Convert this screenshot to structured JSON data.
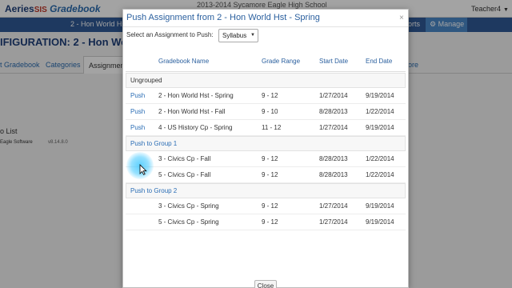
{
  "background": {
    "logo": "Aeries",
    "logo_sis": "SIS",
    "logo_gradebook": "Gradebook",
    "school": "2013-2014 Sycamore Eagle High School",
    "user": "Teacher4",
    "course": "2 - Hon World Hst",
    "reports_label": "orts",
    "manage_label": "Manage",
    "heading": "IFIGURATION: 2 - Hon World",
    "tabs": [
      "t Gradebook",
      "Categories",
      "Assignment",
      "ore"
    ],
    "list_label": "o List",
    "eagle_label": "Eagle Software",
    "version": "v8.14.8.0"
  },
  "modal": {
    "title": "Push Assignment from 2 - Hon World Hst - Spring",
    "close_icon": "×",
    "select_label": "Select an Assignment to Push:",
    "select_value": "Syllabus",
    "columns": {
      "gradebook_name": "Gradebook Name",
      "grade_range": "Grade Range",
      "start_date": "Start Date",
      "end_date": "End Date"
    },
    "groups": [
      {
        "label": "Ungrouped",
        "rows": [
          {
            "action": "Push",
            "name": "2 - Hon World Hst - Spring",
            "range": "9 - 12",
            "start": "1/27/2014",
            "end": "9/19/2014"
          },
          {
            "action": "Push",
            "name": "2 - Hon World Hst - Fall",
            "range": "9 - 10",
            "start": "8/28/2013",
            "end": "1/22/2014"
          },
          {
            "action": "Push",
            "name": "4 - US History Cp - Spring",
            "range": "11 - 12",
            "start": "1/27/2014",
            "end": "9/19/2014"
          }
        ]
      },
      {
        "label": "Push to Group 1",
        "rows": [
          {
            "name": "3 - Civics Cp - Fall",
            "range": "9 - 12",
            "start": "8/28/2013",
            "end": "1/22/2014"
          },
          {
            "name": "5 - Civics Cp - Fall",
            "range": "9 - 12",
            "start": "8/28/2013",
            "end": "1/22/2014"
          }
        ]
      },
      {
        "label": "Push to Group 2",
        "rows": [
          {
            "name": "3 - Civics Cp - Spring",
            "range": "9 - 12",
            "start": "1/27/2014",
            "end": "9/19/2014"
          },
          {
            "name": "5 - Civics Cp - Spring",
            "range": "9 - 12",
            "start": "1/27/2014",
            "end": "9/19/2014"
          }
        ]
      }
    ],
    "close_button": "Close"
  },
  "colors": {
    "link": "#2a6db5",
    "nav_bar": "#2f5a96",
    "manage": "#4a89c9"
  }
}
